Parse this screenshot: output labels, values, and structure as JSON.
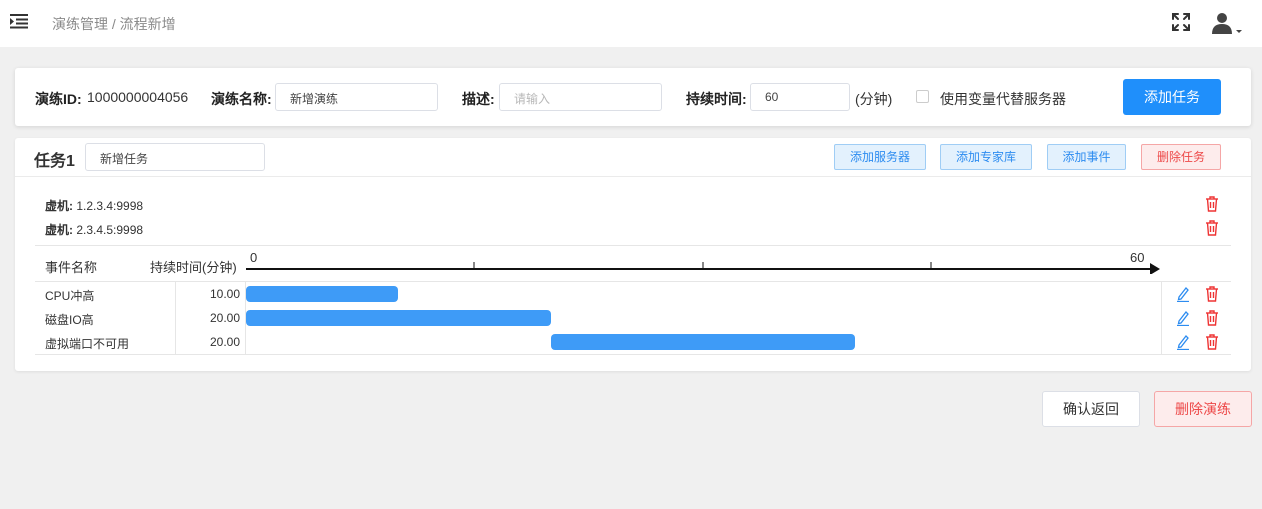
{
  "header": {
    "menu_icon": "menu-fold-icon",
    "breadcrumb": "演练管理 / 流程新增",
    "fullscreen_icon": "fullscreen-icon",
    "user_icon": "user-icon"
  },
  "drill": {
    "id_label": "演练ID:",
    "id_value": "1000000004056",
    "name_label": "演练名称:",
    "name_value": "新增演练",
    "desc_label": "描述:",
    "desc_placeholder": "请输入",
    "duration_label": "持续时间:",
    "duration_value": "60",
    "duration_unit": "(分钟)",
    "use_var_label": "使用变量代替服务器",
    "use_var_checked": false,
    "add_task_label": "添加任务"
  },
  "task": {
    "title": "任务1",
    "name_value": "新增任务",
    "buttons": {
      "add_server": "添加服务器",
      "add_expert": "添加专家库",
      "add_event": "添加事件",
      "delete_task": "删除任务"
    },
    "vms": [
      {
        "label": "虚机:",
        "value": "1.2.3.4:9998"
      },
      {
        "label": "虚机:",
        "value": "2.3.4.5:9998"
      }
    ],
    "timeline": {
      "col_event": "事件名称",
      "col_duration": "持续时间(分钟)",
      "axis_start": "0",
      "axis_end": "60",
      "axis_max": 60
    },
    "events": [
      {
        "name": "CPU冲高",
        "duration": "10.00",
        "start": 0,
        "length": 10
      },
      {
        "name": "磁盘IO高",
        "duration": "20.00",
        "start": 0,
        "length": 20
      },
      {
        "name": "虚拟端口不可用",
        "duration": "20.00",
        "start": 20,
        "length": 20
      }
    ]
  },
  "footer": {
    "confirm_back": "确认返回",
    "delete_drill": "删除演练"
  },
  "colors": {
    "primary": "#1f8ffb",
    "bar": "#3e9bf7",
    "danger": "#ed4848"
  }
}
